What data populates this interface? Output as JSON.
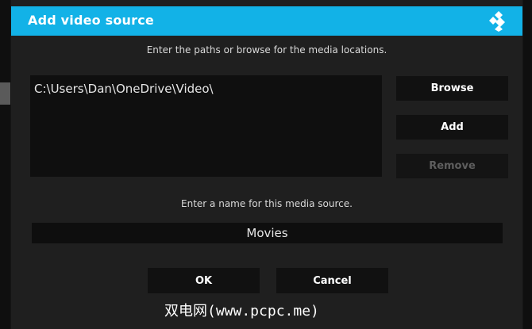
{
  "dialog": {
    "title": "Add video source",
    "logo_icon": "kodi-logo-icon",
    "header_color": "#12b2e7"
  },
  "paths": {
    "instructions": "Enter the paths or browse for the media locations.",
    "items": [
      "C:\\Users\\Dan\\OneDrive\\Video\\"
    ]
  },
  "buttons": {
    "browse": "Browse",
    "add": "Add",
    "remove": "Remove"
  },
  "name": {
    "prompt": "Enter a name for this media source.",
    "value": "Movies"
  },
  "actions": {
    "ok": "OK",
    "cancel": "Cancel"
  },
  "watermark": "双电网(www.pcpc.me)"
}
